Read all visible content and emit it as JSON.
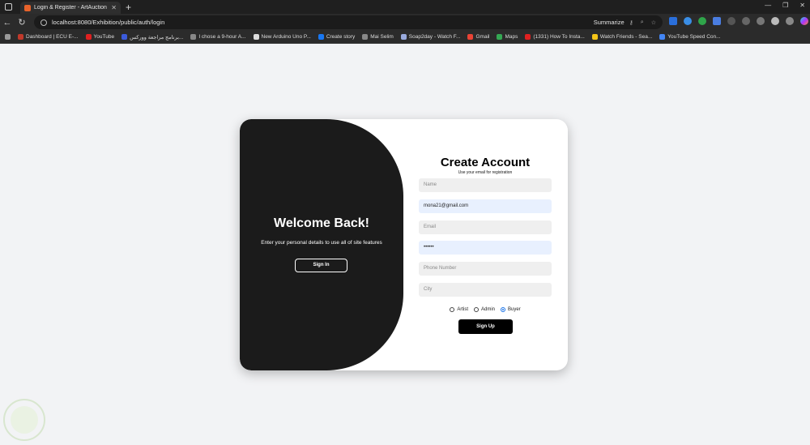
{
  "browser": {
    "tab_title": "Login & Register - ArtAuction",
    "tab_close": "✕",
    "new_tab": "+",
    "url": "localhost:8080/Exhibition/public/auth/login",
    "summarize": "Summarize",
    "window_controls": [
      "—",
      "❐",
      "✕"
    ],
    "bookmarks": [
      {
        "label": "Dashboard | ECU E-...",
        "color": "#c0392b"
      },
      {
        "label": "YouTube",
        "color": "#e02020"
      },
      {
        "label": "برنامج مراجعة ووركس...",
        "color": "#3b5bdb"
      },
      {
        "label": "I chose a 9-hour A...",
        "color": "#888888"
      },
      {
        "label": "New Arduino Uno P...",
        "color": "#dddddd"
      },
      {
        "label": "Create story",
        "color": "#1877f2"
      },
      {
        "label": "Mai Selim",
        "color": "#888888"
      },
      {
        "label": "Soap2day - Watch F...",
        "color": "#9ad"
      },
      {
        "label": "Gmail",
        "color": "#ea4335"
      },
      {
        "label": "Maps",
        "color": "#34a853"
      },
      {
        "label": "(1331) How To Insta...",
        "color": "#e02020"
      },
      {
        "label": "Watch Friends - Sea...",
        "color": "#f5c518"
      },
      {
        "label": "YouTube Speed Con...",
        "color": "#4285f4"
      }
    ]
  },
  "left_panel": {
    "title": "Welcome Back!",
    "subtitle": "Enter your personal details to use all of site features",
    "button": "Sign In"
  },
  "form": {
    "title": "Create Account",
    "subtitle": "Use your email for registration",
    "fields": {
      "name_placeholder": "Name",
      "username_value": "mona21@gmail.com",
      "email_placeholder": "Email",
      "password_value": "••••••",
      "phone_placeholder": "Phone Number",
      "city_placeholder": "City"
    },
    "roles": [
      "Artist",
      "Admin",
      "Buyer"
    ],
    "selected_role": "Buyer",
    "submit": "Sign Up"
  },
  "colors": {
    "dark_panel": "#1b1b1b",
    "page_bg": "#f2f3f5",
    "autofill_bg": "#e8f0fe"
  }
}
